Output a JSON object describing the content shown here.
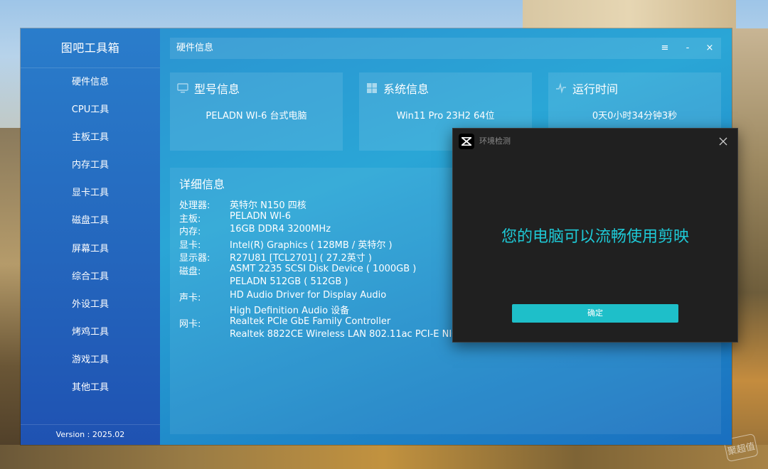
{
  "app": {
    "title": "图吧工具箱",
    "version": "Version : 2025.02"
  },
  "sidebar": {
    "items": [
      {
        "label": "硬件信息"
      },
      {
        "label": "CPU工具"
      },
      {
        "label": "主板工具"
      },
      {
        "label": "内存工具"
      },
      {
        "label": "显卡工具"
      },
      {
        "label": "磁盘工具"
      },
      {
        "label": "屏幕工具"
      },
      {
        "label": "综合工具"
      },
      {
        "label": "外设工具"
      },
      {
        "label": "烤鸡工具"
      },
      {
        "label": "游戏工具"
      },
      {
        "label": "其他工具"
      }
    ]
  },
  "titlebar": {
    "title": "硬件信息",
    "menu_glyph": "≡",
    "minimize_glyph": "-",
    "close_glyph": "×"
  },
  "cards": {
    "model": {
      "title": "型号信息",
      "value": "PELADN WI-6 台式电脑",
      "icon": "monitor-icon"
    },
    "system": {
      "title": "系统信息",
      "value": "Win11 Pro 23H2 64位",
      "icon": "windows-logo-icon"
    },
    "uptime": {
      "title": "运行时间",
      "value": "0天0小时34分钟3秒",
      "icon": "pulse-icon"
    }
  },
  "details": {
    "title": "详细信息",
    "rows": [
      {
        "label": "处理器:",
        "value": "英特尔 N150 四核"
      },
      {
        "label": "主板:",
        "value": "PELADN WI-6"
      },
      {
        "label": "内存:",
        "value": "16GB DDR4 3200MHz"
      },
      {
        "label": "显卡:",
        "value": "Intel(R) Graphics ( 128MB / 英特尔 )"
      },
      {
        "label": "显示器:",
        "value": "R27U81 [TCL2701] ( 27.2英寸 )"
      },
      {
        "label": "磁盘:",
        "value": "ASMT 2235 SCSI Disk Device ( 1000GB )"
      },
      {
        "label": "",
        "value": "PELADN 512GB ( 512GB )"
      },
      {
        "label": "声卡:",
        "value": "HD Audio Driver for Display Audio"
      },
      {
        "label": "",
        "value": "High Definition Audio 设备"
      },
      {
        "label": "网卡:",
        "value": "Realtek PCIe GbE Family Controller"
      },
      {
        "label": "",
        "value": "Realtek 8822CE Wireless LAN 802.11ac PCI-E NIC"
      }
    ]
  },
  "dialog": {
    "title": "环境检测",
    "message": "您的电脑可以流畅使用剪映",
    "confirm_label": "确定",
    "accent_color": "#1ec9d6"
  },
  "watermark": "聚超值"
}
